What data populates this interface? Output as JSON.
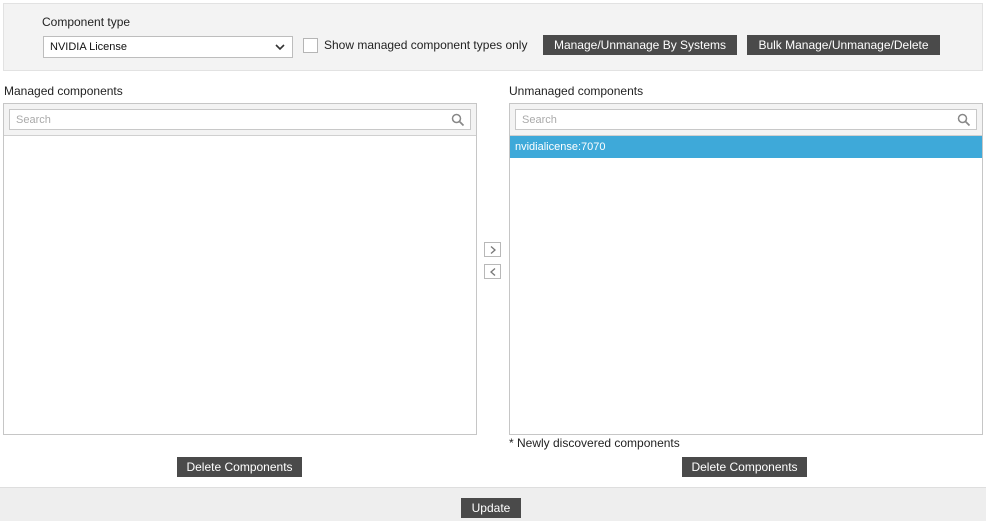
{
  "component_type": {
    "label": "Component type",
    "selected": "NVIDIA License"
  },
  "show_managed_only": {
    "label": "Show managed component types only",
    "checked": false
  },
  "toolbar": {
    "manage_by_systems_label": "Manage/Unmanage By Systems",
    "bulk_label": "Bulk Manage/Unmanage/Delete"
  },
  "managed": {
    "title": "Managed components",
    "search_placeholder": "Search",
    "items": [],
    "delete_label": "Delete Components"
  },
  "unmanaged": {
    "title": "Unmanaged components",
    "search_placeholder": "Search",
    "items": [
      "nvidialicense:7070"
    ],
    "delete_label": "Delete Components",
    "note": "* Newly discovered components"
  },
  "footer": {
    "update_label": "Update"
  },
  "colors": {
    "button_bg": "#4a4a4a",
    "selection": "#3ea9d9",
    "panel_bg": "#f3f3f3"
  }
}
